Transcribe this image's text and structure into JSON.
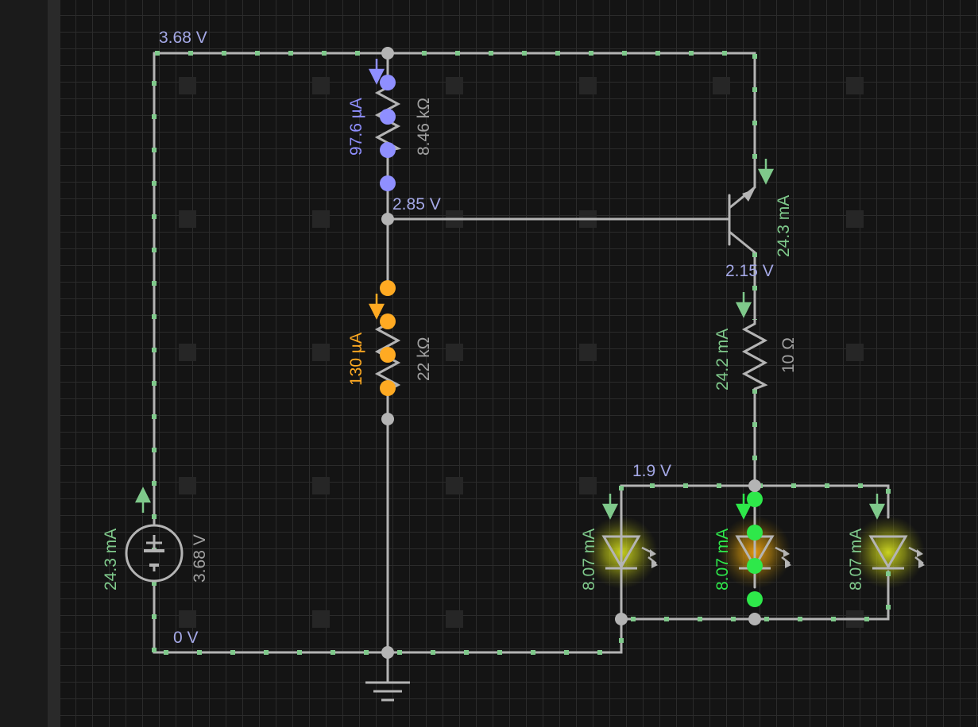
{
  "labels": {
    "top_voltage": "3.68 V",
    "base_voltage": "2.85 V",
    "emitter_voltage": "2.15 V",
    "led_voltage": "1.9 V",
    "ground_voltage": "0 V",
    "r1_current": "97.6 µA",
    "r1_resistance": "8.46 kΩ",
    "r2_current": "130 µA",
    "r2_resistance": "22 kΩ",
    "transistor_current": "24.3 mA",
    "r3_current": "24.2 mA",
    "r3_resistance": "10 Ω",
    "battery_current": "24.3 mA",
    "battery_voltage": "3.68 V",
    "led1_current": "8.07 mA",
    "led2_current": "8.07 mA",
    "led3_current": "8.07 mA"
  },
  "colors": {
    "background": "#141414",
    "grid": "#2b2b2b",
    "wire": "#b4b4b4",
    "voltage_label": "#a4a8e6",
    "current_green": "#7fc98b",
    "r1_particle": "#8f8fff",
    "r2_particle": "#ffaa22",
    "led_particle": "#2ee84a",
    "led_glow": "#c8d21e",
    "led_glow_active": "#e7a316"
  },
  "icons": {
    "battery": "battery-icon",
    "transistor": "npn-transistor-icon",
    "resistor": "resistor-icon",
    "led": "led-icon",
    "ground": "ground-icon",
    "current_arrow": "arrow-icon"
  }
}
